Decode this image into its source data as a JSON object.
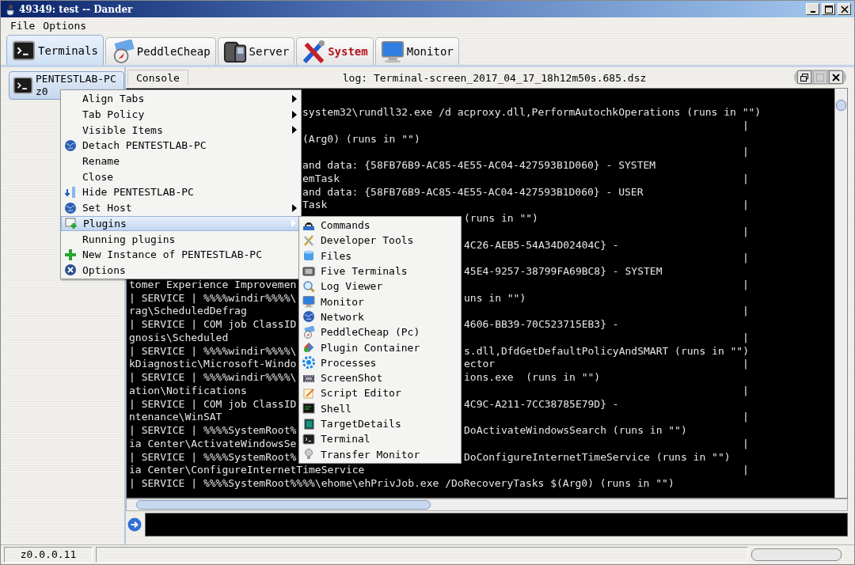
{
  "window": {
    "title": "49349: test -- Dander"
  },
  "menu_bar": [
    "File",
    "Options"
  ],
  "tabs": [
    {
      "label": "Terminals",
      "selected": true,
      "color": "#000000"
    },
    {
      "label": "PeddleCheap",
      "selected": false,
      "color": "#000000"
    },
    {
      "label": "Server",
      "selected": false,
      "color": "#000000"
    },
    {
      "label": "System",
      "selected": false,
      "color": "#b3141c"
    },
    {
      "label": "Monitor",
      "selected": false,
      "color": "#000000"
    }
  ],
  "host_tab": {
    "name": "PENTESTLAB-PC",
    "address": "z0",
    "selected": true
  },
  "console": {
    "tab": "Console",
    "log_title": "log: Terminal-screen_2017_04_17_18h12m50s.685.dsz",
    "lines": [
      {
        "mid": "system32\\rundll32.exe /d acproxy.dll,PerformAutochkOperations (runs in \"\")"
      },
      {
        "edge": "|"
      },
      {
        "mid": "(Arg0) (runs in \"\")"
      },
      {
        "edge": "|"
      },
      {
        "mid": "and data: {58FB76B9-AC85-4E55-AC04-427593B1D060} - SYSTEM"
      },
      {
        "mid": "emTask",
        "edge": "|"
      },
      {
        "mid": "and data: {58FB76B9-AC85-4E55-AC04-427593B1D060} - USER"
      },
      {
        "mid": "Task",
        "edge": "|"
      },
      {
        "right": "(runs in \"\")"
      },
      {
        "edge": "|"
      },
      {
        "right": "4C26-AEB5-54A34D02404C} -"
      },
      {
        "edge": "|"
      },
      {
        "right": "45E4-9257-38799FA69BC8} - SYSTEM"
      },
      {
        "left": "tomer Experience Improvemen",
        "edge": "|"
      },
      {
        "left": "| SERVICE | %%%%windir%%%%\\",
        "right": "uns in \"\")"
      },
      {
        "left": "rag\\ScheduledDefrag",
        "edge": "|"
      },
      {
        "left": "| SERVICE | COM job ClassID",
        "right": "4606-BB39-70C523715EB3} -"
      },
      {
        "left": "gnosis\\Scheduled",
        "edge": "|"
      },
      {
        "left": "| SERVICE | %%%%windir%%%%\\",
        "right": "s.dll,DfdGetDefaultPolicyAndSMART (runs in \"\")"
      },
      {
        "left": "kDiagnostic\\Microsoft-Windo",
        "right": "ector",
        "edge": "|"
      },
      {
        "left": "| SERVICE | %%%%windir%%%%\\",
        "right": "ions.exe  (runs in \"\")"
      },
      {
        "left": "ation\\Notifications",
        "edge": "|"
      },
      {
        "left": "| SERVICE | COM job ClassID",
        "right": "4C9C-A211-7CC38785E79D} -"
      },
      {
        "left": "ntenance\\WinSAT",
        "edge": "|"
      },
      {
        "left": "| SERVICE | %%%%SystemRoot%",
        "right": "DoActivateWindowsSearch (runs in \"\")"
      },
      {
        "left": "ia Center\\ActivateWindowsSe",
        "edge": "|"
      },
      {
        "left": "| SERVICE | %%%%SystemRoot%",
        "right": "DoConfigureInternetTimeService (runs in \"\")"
      },
      {
        "left": "ia Center\\ConfigureInternetTimeService",
        "edge": "|"
      },
      {
        "left": "| SERVICE | %%%%SystemRoot%%%%\\ehome\\ehPrivJob.exe /DoRecoveryTasks $(Arg0) (runs in \"\")"
      }
    ]
  },
  "context_menu": {
    "items": [
      {
        "label": "Align Tabs",
        "submenu": true,
        "selected": false
      },
      {
        "label": "Tab Policy",
        "submenu": true,
        "selected": false
      },
      {
        "label": "Visible Items",
        "submenu": true,
        "selected": false
      },
      {
        "label": "Detach PENTESTLAB-PC",
        "submenu": false,
        "selected": false
      },
      {
        "label": "Rename",
        "submenu": false,
        "selected": false
      },
      {
        "label": "Close",
        "submenu": false,
        "selected": false
      },
      {
        "label": "Hide PENTESTLAB-PC",
        "submenu": false,
        "selected": false
      },
      {
        "label": "Set Host",
        "submenu": true,
        "selected": false
      },
      {
        "label": "Plugins",
        "submenu": true,
        "selected": true
      },
      {
        "label": "Running plugins",
        "submenu": false,
        "selected": false
      },
      {
        "label": "New Instance of PENTESTLAB-PC",
        "submenu": false,
        "selected": false
      },
      {
        "label": "Options",
        "submenu": false,
        "selected": false
      }
    ]
  },
  "plugins_menu": {
    "items": [
      {
        "label": "Commands",
        "selected": false
      },
      {
        "label": "Developer Tools",
        "selected": false
      },
      {
        "label": "Files",
        "selected": false
      },
      {
        "label": "Five Terminals",
        "selected": false
      },
      {
        "label": "Log Viewer",
        "selected": false
      },
      {
        "label": "Monitor",
        "selected": false
      },
      {
        "label": "Network",
        "selected": false
      },
      {
        "label": "PeddleCheap (Pc)",
        "selected": false
      },
      {
        "label": "Plugin Container",
        "selected": false
      },
      {
        "label": "Processes",
        "selected": false
      },
      {
        "label": "ScreenShot",
        "selected": false
      },
      {
        "label": "Script Editor",
        "selected": false
      },
      {
        "label": "Shell",
        "selected": false
      },
      {
        "label": "TargetDetails",
        "selected": false
      },
      {
        "label": "Terminal",
        "selected": false
      },
      {
        "label": "Transfer Monitor",
        "selected": false
      }
    ]
  },
  "status_bar": {
    "address": "z0.0.0.11",
    "progress": {
      "level": 0
    }
  }
}
